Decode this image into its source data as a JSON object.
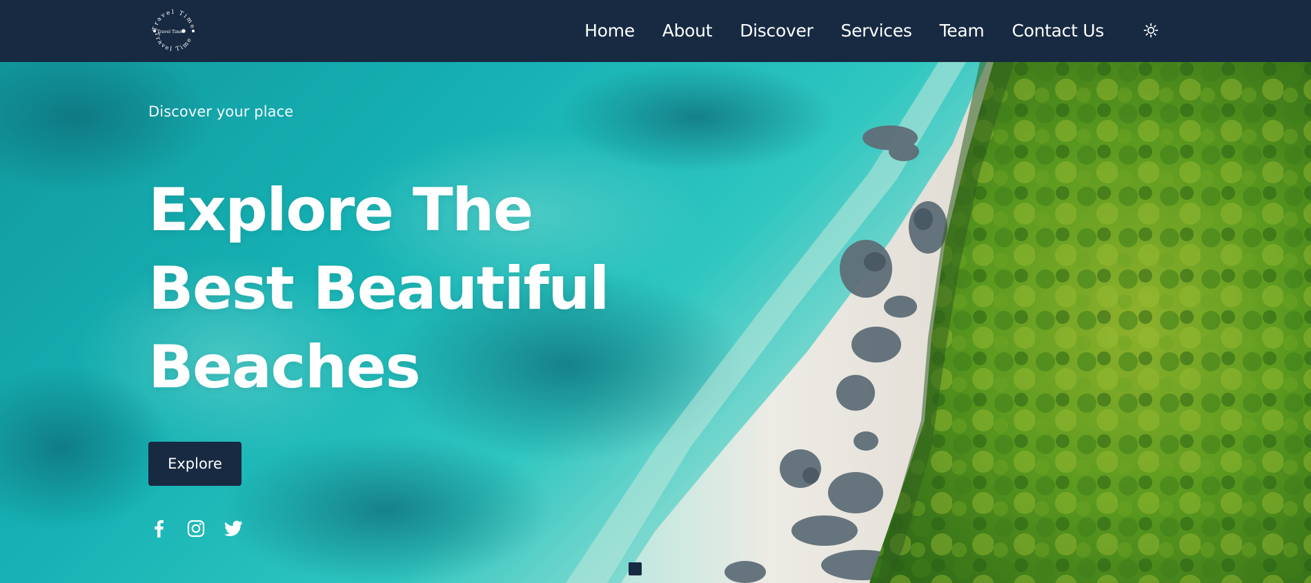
{
  "brand": {
    "logo_ring_text": "Travel Time",
    "logo_center_text": "Travel Time"
  },
  "nav": {
    "items": [
      {
        "label": "Home"
      },
      {
        "label": "About"
      },
      {
        "label": "Discover"
      },
      {
        "label": "Services"
      },
      {
        "label": "Team"
      },
      {
        "label": "Contact Us"
      }
    ],
    "theme_toggle_icon": "sun-icon"
  },
  "hero": {
    "eyebrow": "Discover your place",
    "title_lines": [
      "Explore The",
      "Best Beautiful",
      "Beaches"
    ],
    "cta_label": "Explore",
    "socials": [
      {
        "icon": "facebook-icon"
      },
      {
        "icon": "instagram-icon"
      },
      {
        "icon": "twitter-icon"
      }
    ],
    "slide_indicator_active": 1
  },
  "colors": {
    "header_bg": "#172a42",
    "button_bg": "#172a42",
    "text": "#ffffff",
    "water": "#1fb9b8",
    "sand": "#efe6df",
    "forest": "#4f8d1f"
  }
}
